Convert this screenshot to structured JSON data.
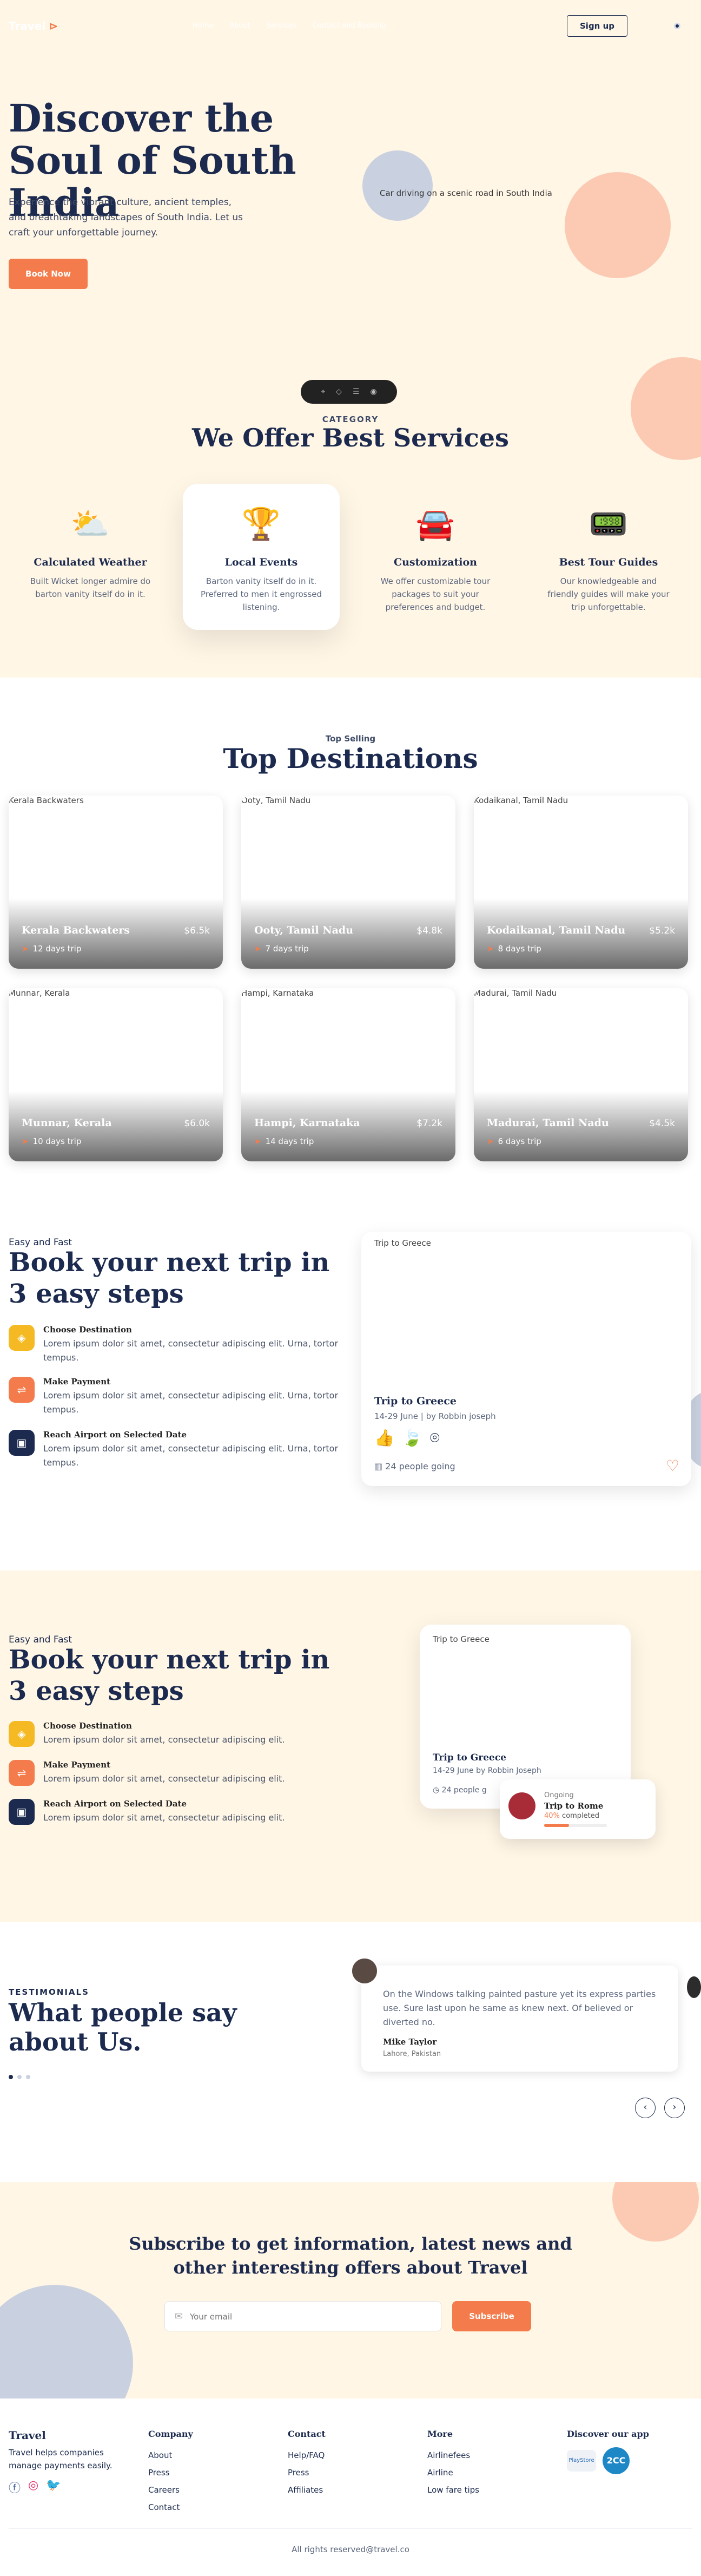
{
  "nav": {
    "logo": "Travel",
    "links": [
      "Home",
      "About",
      "Services",
      "Contact and Booking"
    ],
    "signup": "Sign up"
  },
  "hero": {
    "title": "Discover the Soul of South India",
    "description": "Experience the vibrant culture, ancient temples, and breathtaking landscapes of South India. Let us craft your unforgettable journey.",
    "cta": "Book Now",
    "image_alt": "Car driving on a scenic road in South India"
  },
  "services": {
    "label": "CATEGORY",
    "title": "We Offer Best Services",
    "items": [
      {
        "icon": "weather-icon",
        "title": "Calculated Weather",
        "desc": "Built Wicket longer admire do barton vanity itself do in it."
      },
      {
        "icon": "trophy-icon",
        "title": "Local Events",
        "desc": "Barton vanity itself do in it. Preferred to men it engrossed listening."
      },
      {
        "icon": "car-icon",
        "title": "Customization",
        "desc": "We offer customizable tour packages to suit your preferences and budget."
      },
      {
        "icon": "guide-icon",
        "title": "Best Tour Guides",
        "desc": "Our knowledgeable and friendly guides will make your trip unforgettable."
      }
    ]
  },
  "destinations": {
    "sub": "Top Selling",
    "title": "Top Destinations",
    "cards": [
      {
        "alt": "Kerala Backwaters",
        "name": "Kerala Backwaters",
        "price": "$6.5k",
        "days": "12 days trip"
      },
      {
        "alt": "Ooty, Tamil Nadu",
        "name": "Ooty, Tamil Nadu",
        "price": "$4.8k",
        "days": "7 days trip"
      },
      {
        "alt": "Kodaikanal, Tamil Nadu",
        "name": "Kodaikanal, Tamil Nadu",
        "price": "$5.2k",
        "days": "8 days trip"
      },
      {
        "alt": "Munnar, Kerala",
        "name": "Munnar, Kerala",
        "price": "$6.0k",
        "days": "10 days trip"
      },
      {
        "alt": "Hampi, Karnataka",
        "name": "Hampi, Karnataka",
        "price": "$7.2k",
        "days": "14 days trip"
      },
      {
        "alt": "Madurai, Tamil Nadu",
        "name": "Madurai, Tamil Nadu",
        "price": "$4.5k",
        "days": "6 days trip"
      }
    ]
  },
  "stepsA": {
    "eyebrow": "Easy and Fast",
    "title": "Book your next trip in 3 easy steps",
    "steps": [
      {
        "title": "Choose Destination",
        "desc": "Lorem ipsum dolor sit amet, consectetur adipiscing elit. Urna, tortor tempus."
      },
      {
        "title": "Make Payment",
        "desc": "Lorem ipsum dolor sit amet, consectetur adipiscing elit. Urna, tortor tempus."
      },
      {
        "title": "Reach Airport on Selected Date",
        "desc": "Lorem ipsum dolor sit amet, consectetur adipiscing elit. Urna, tortor tempus."
      }
    ],
    "card": {
      "alt": "Trip to Greece",
      "title": "Trip to Greece",
      "meta": "14-29 June | by Robbin joseph",
      "going": "24 people going"
    }
  },
  "stepsB": {
    "eyebrow": "Easy and Fast",
    "title": "Book your next trip in 3 easy steps",
    "steps": [
      {
        "title": "Choose Destination",
        "desc": "Lorem ipsum dolor sit amet, consectetur adipiscing elit."
      },
      {
        "title": "Make Payment",
        "desc": "Lorem ipsum dolor sit amet, consectetur adipiscing elit."
      },
      {
        "title": "Reach Airport on Selected Date",
        "desc": "Lorem ipsum dolor sit amet, consectetur adipiscing elit."
      }
    ],
    "card": {
      "alt": "Trip to Greece",
      "title": "Trip to Greece",
      "meta": "14-29 June by Robbin Joseph",
      "going": "24 people g"
    },
    "ongoing": {
      "label": "Ongoing",
      "title": "Trip to Rome",
      "percent": "40%",
      "completed": "completed",
      "progress": 0.4
    }
  },
  "testimonials": {
    "label": "TESTIMONIALS",
    "title": "What people say about Us.",
    "quote": "On the Windows talking painted pasture yet its express parties use. Sure last upon he same as knew next. Of believed or diverted no.",
    "name": "Mike Taylor",
    "location": "Lahore, Pakistan",
    "prev": "‹",
    "next": "›"
  },
  "subscribe": {
    "title": "Subscribe to get information, latest news and other interesting offers about Travel",
    "placeholder": "Your email",
    "button": "Subscribe"
  },
  "footer": {
    "brand": "Travel",
    "desc": "Travel helps companies manage payments easily.",
    "columns": [
      {
        "title": "Company",
        "links": [
          "About",
          "Press",
          "Careers",
          "Contact"
        ]
      },
      {
        "title": "Contact",
        "links": [
          "Help/FAQ",
          "Press",
          "Affiliates"
        ]
      },
      {
        "title": "More",
        "links": [
          "Airlinefees",
          "Airline",
          "Low fare tips"
        ]
      }
    ],
    "app_title": "Discover our app",
    "badge_google": "PlayStore",
    "badge_other": "2CC",
    "copyright": "All rights reserved@travel.co"
  },
  "colors": {
    "accent": "#f47c4c",
    "navy": "#1b2a4e",
    "cream": "#fff6e6",
    "peach": "#fccab3",
    "grey_blob": "#c9d1e0"
  }
}
